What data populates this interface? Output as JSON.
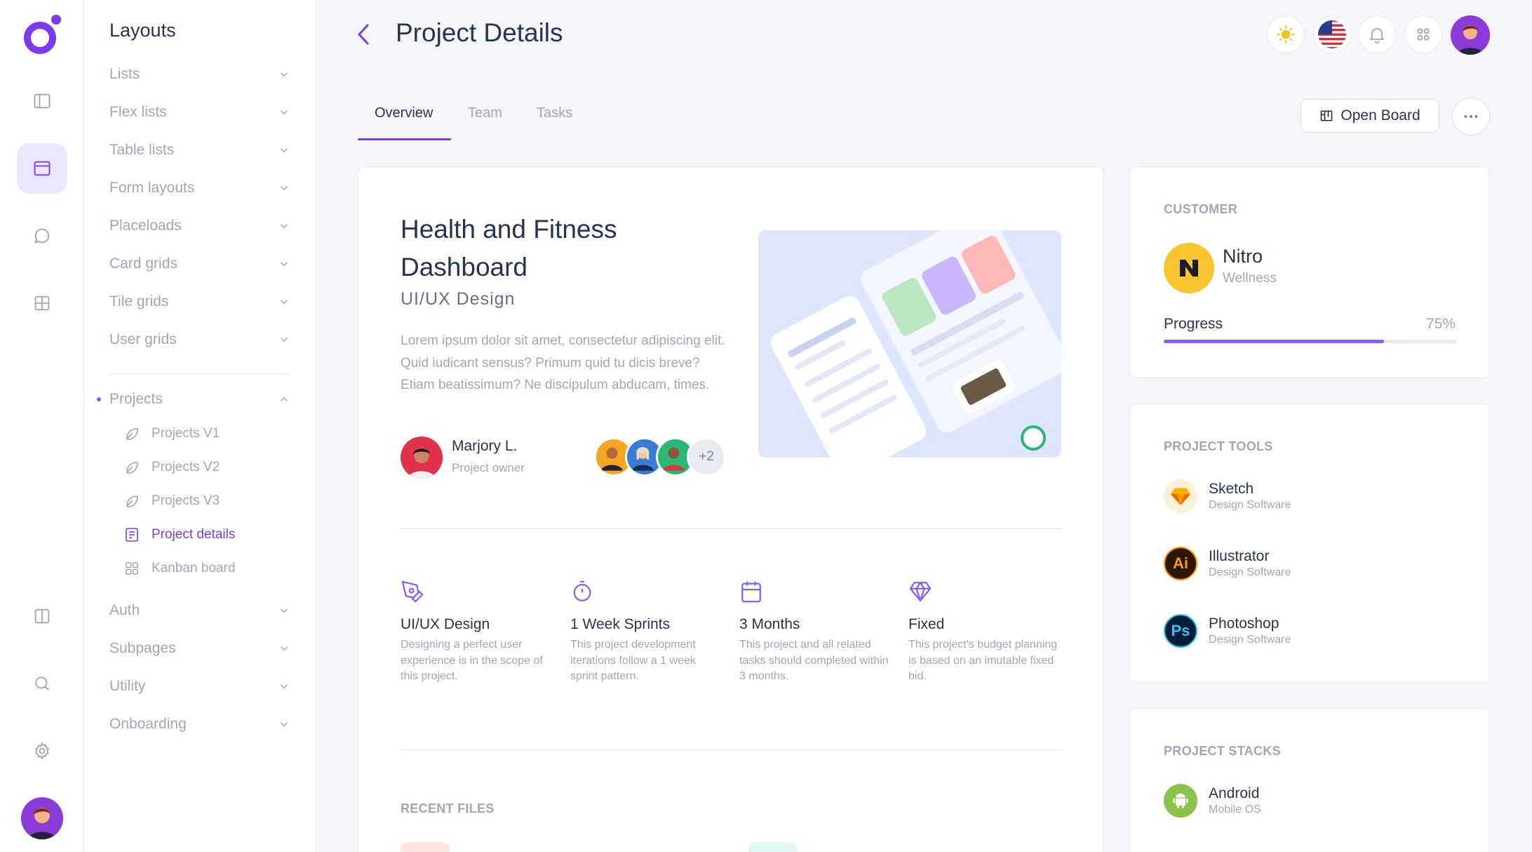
{
  "header": {
    "title": "Project Details"
  },
  "menu": {
    "title": "Layouts",
    "items": [
      {
        "label": "Lists"
      },
      {
        "label": "Flex lists"
      },
      {
        "label": "Table lists"
      },
      {
        "label": "Form layouts"
      },
      {
        "label": "Placeloads"
      },
      {
        "label": "Card grids"
      },
      {
        "label": "Tile grids"
      },
      {
        "label": "User grids"
      }
    ],
    "projects": {
      "label": "Projects",
      "children": [
        {
          "label": "Projects V1"
        },
        {
          "label": "Projects V2"
        },
        {
          "label": "Projects V3"
        },
        {
          "label": "Project details"
        },
        {
          "label": "Kanban board"
        }
      ]
    },
    "bottom_items": [
      {
        "label": "Auth"
      },
      {
        "label": "Subpages"
      },
      {
        "label": "Utility"
      },
      {
        "label": "Onboarding"
      }
    ]
  },
  "tabs": [
    {
      "label": "Overview"
    },
    {
      "label": "Team"
    },
    {
      "label": "Tasks"
    }
  ],
  "actions": {
    "open_board": "Open Board"
  },
  "project": {
    "title": "Health and Fitness Dashboard",
    "subtitle": "UI/UX Design",
    "description": "Lorem ipsum dolor sit amet, consectetur adipiscing elit. Quid iudicant sensus? Primum quid tu dicis breve? Etiam beatissimum? Ne discipulum abducam, times.",
    "owner": {
      "name": "Marjory L.",
      "role": "Project owner"
    },
    "team_more": "+2"
  },
  "features": [
    {
      "icon": "pen-tool-icon",
      "title": "UI/UX Design",
      "desc": "Designing a perfect user experience is in the scope of this project."
    },
    {
      "icon": "stopwatch-icon",
      "title": "1 Week Sprints",
      "desc": "This project development iterations follow a 1 week sprint pattern."
    },
    {
      "icon": "calendar-icon",
      "title": "3 Months",
      "desc": "This project and all related tasks should completed within 3 months."
    },
    {
      "icon": "diamond-icon",
      "title": "Fixed",
      "desc": "This project's budget planning is based on an imutable fixed bid."
    }
  ],
  "recent_files": {
    "title": "RECENT FILES"
  },
  "customer": {
    "label": "CUSTOMER",
    "name": "Nitro",
    "sub": "Wellness",
    "progress_label": "Progress",
    "progress_text": "75%",
    "progress": 0.75
  },
  "project_tools": {
    "label": "PROJECT TOOLS",
    "items": [
      {
        "name": "Sketch",
        "sub": "Design Software"
      },
      {
        "name": "Illustrator",
        "sub": "Design Software",
        "glyph": "Ai"
      },
      {
        "name": "Photoshop",
        "sub": "Design Software",
        "glyph": "Ps"
      }
    ]
  },
  "project_stacks": {
    "label": "PROJECT STACKS",
    "items": [
      {
        "name": "Android",
        "sub": "Mobile OS"
      }
    ]
  },
  "colors": {
    "accent": "#7c3aed",
    "muted": "#a2a5b9",
    "text": "#283252",
    "customer_logo": "#f8c430"
  }
}
